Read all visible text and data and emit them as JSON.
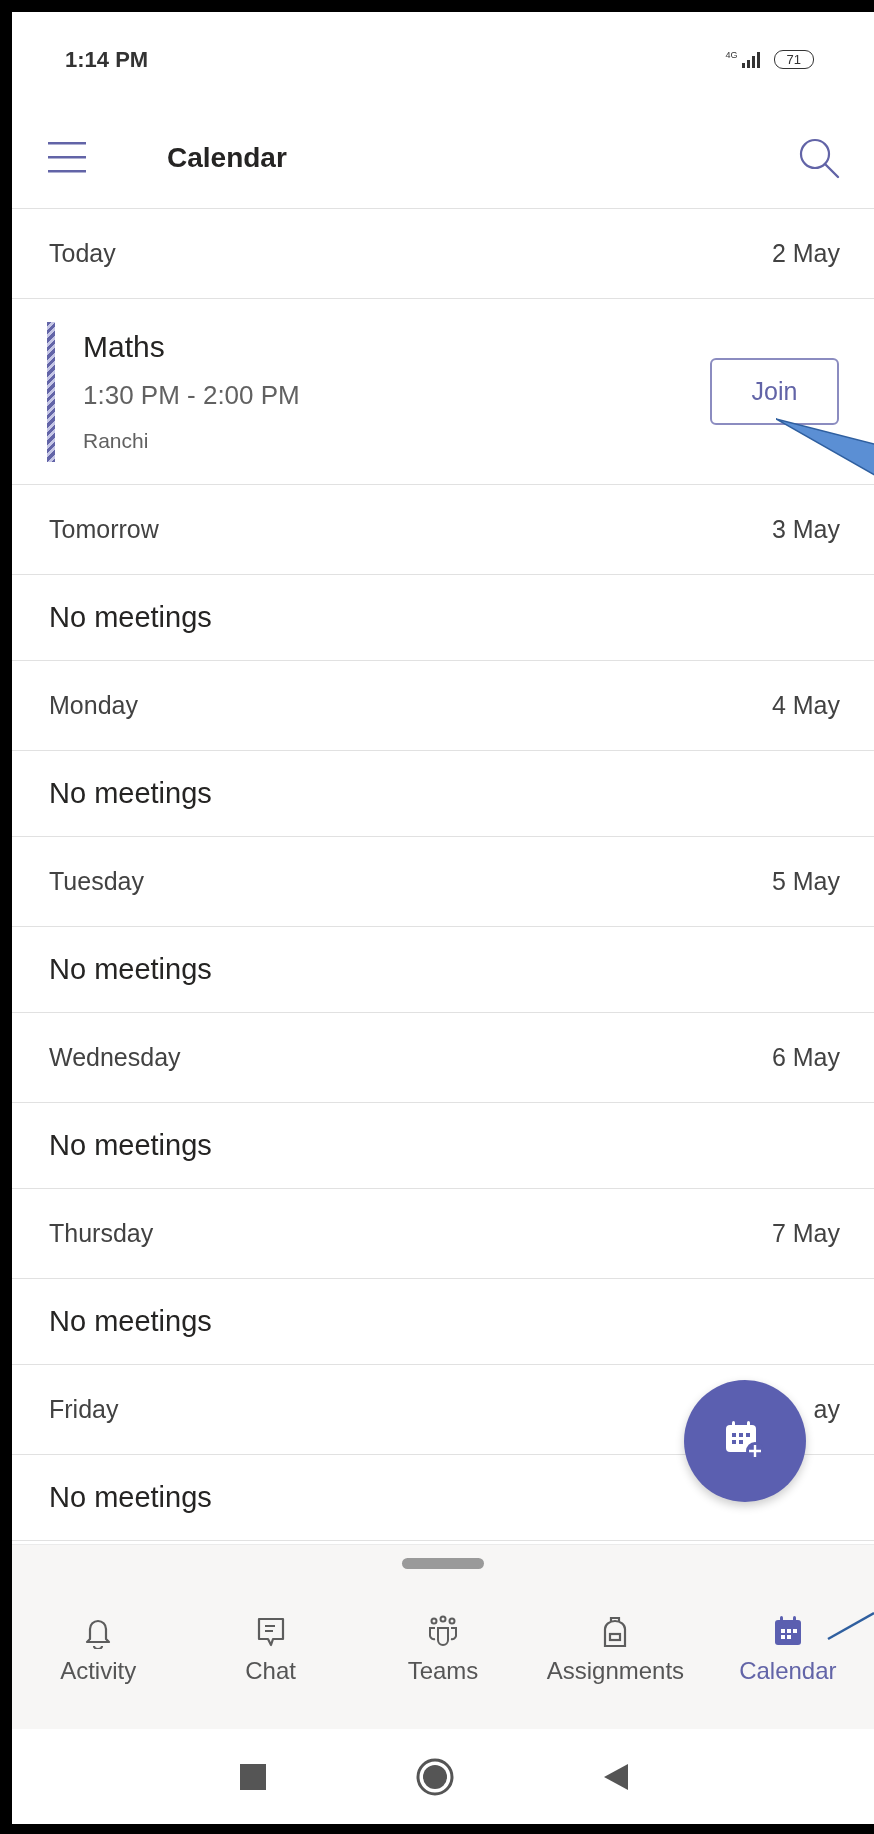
{
  "status_bar": {
    "time": "1:14 PM",
    "network": "4G",
    "battery": "71"
  },
  "app_bar": {
    "title": "Calendar"
  },
  "days": [
    {
      "label": "Today",
      "date": "2 May",
      "events": [
        {
          "title": "Maths",
          "time": "1:30 PM - 2:00 PM",
          "location": "Ranchi",
          "action": "Join"
        }
      ]
    },
    {
      "label": "Tomorrow",
      "date": "3 May",
      "empty_text": "No meetings"
    },
    {
      "label": "Monday",
      "date": "4 May",
      "empty_text": "No meetings"
    },
    {
      "label": "Tuesday",
      "date": "5 May",
      "empty_text": "No meetings"
    },
    {
      "label": "Wednesday",
      "date": "6 May",
      "empty_text": "No meetings"
    },
    {
      "label": "Thursday",
      "date": "7 May",
      "empty_text": "No meetings"
    },
    {
      "label": "Friday",
      "date": "ay",
      "empty_text": "No meetings"
    }
  ],
  "tabs": [
    {
      "label": "Activity",
      "selected": false
    },
    {
      "label": "Chat",
      "selected": false
    },
    {
      "label": "Teams",
      "selected": false
    },
    {
      "label": "Assignments",
      "selected": false
    },
    {
      "label": "Calendar",
      "selected": true
    }
  ]
}
